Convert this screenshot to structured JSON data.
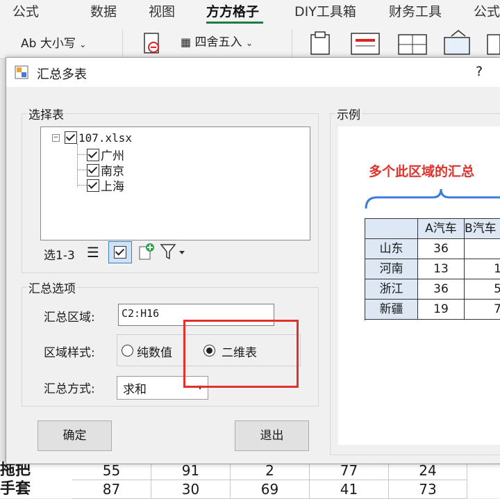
{
  "ribbon": {
    "tabs": [
      "公式",
      "数据",
      "视图",
      "方方格子",
      "DIY工具箱",
      "财务工具",
      "公式"
    ],
    "active_tab": "方方格子",
    "case_label": "Ab 大小写",
    "round_label": "四舍五入"
  },
  "dialog": {
    "title": "汇总多表",
    "help": "?",
    "select_group_label": "选择表",
    "tree": {
      "root": "107.xlsx",
      "children": [
        "广州",
        "南京",
        "上海"
      ]
    },
    "toolbar_select_label": "选1-3",
    "options_group_label": "汇总选项",
    "range_label": "汇总区域:",
    "range_value": "C2:H16",
    "style_label": "区域样式:",
    "style_option_plain": "纯数值",
    "style_option_2d": "二维表",
    "style_selected": "二维表",
    "method_label": "汇总方式:",
    "method_value": "求和",
    "ok_label": "确定",
    "exit_label": "退出",
    "example_label": "示例",
    "example_caption": "多个此区域的汇总",
    "example_table": {
      "headers": [
        "",
        "A汽车",
        "B汽车"
      ],
      "rows": [
        [
          "山东",
          "36",
          ""
        ],
        [
          "河南",
          "13",
          "1"
        ],
        [
          "浙江",
          "36",
          "5"
        ],
        [
          "新疆",
          "19",
          "7"
        ]
      ]
    },
    "highlight_color": "#e0312b"
  },
  "sheet": {
    "rows": [
      {
        "label": "拖把",
        "values": [
          "55",
          "91",
          "2",
          "77",
          "24"
        ]
      },
      {
        "label": "手套",
        "values": [
          "87",
          "30",
          "69",
          "41",
          "73"
        ]
      }
    ]
  }
}
